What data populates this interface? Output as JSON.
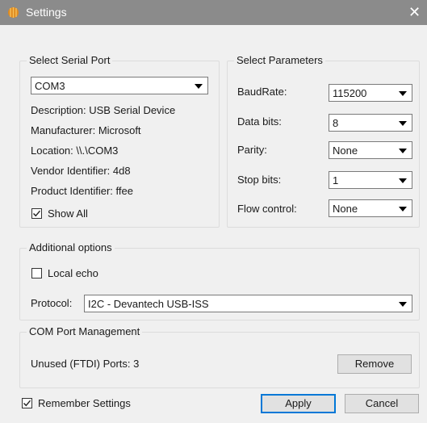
{
  "window": {
    "title": "Settings",
    "close_glyph": "✕"
  },
  "serial_port": {
    "legend": "Select Serial Port",
    "port": "COM3",
    "description": "Description: USB Serial Device",
    "manufacturer": "Manufacturer: Microsoft",
    "location": "Location: \\\\.\\COM3",
    "vendor_id": "Vendor Identifier: 4d8",
    "product_id": "Product Identifier: ffee",
    "show_all_label": "Show All",
    "show_all_checked": true
  },
  "parameters": {
    "legend": "Select Parameters",
    "baud_rate": {
      "label": "BaudRate:",
      "value": "115200"
    },
    "data_bits": {
      "label": "Data bits:",
      "value": "8"
    },
    "parity": {
      "label": "Parity:",
      "value": "None"
    },
    "stop_bits": {
      "label": "Stop bits:",
      "value": "1"
    },
    "flow_control": {
      "label": "Flow control:",
      "value": "None"
    }
  },
  "additional": {
    "legend": "Additional options",
    "local_echo_label": "Local echo",
    "local_echo_checked": false,
    "protocol_label": "Protocol:",
    "protocol_value": "I2C - Devantech USB-ISS"
  },
  "com_mgmt": {
    "legend": "COM Port Management",
    "unused_ports": "Unused (FTDI) Ports: 3",
    "remove_label": "Remove"
  },
  "footer": {
    "remember_label": "Remember Settings",
    "remember_checked": true,
    "apply_label": "Apply",
    "cancel_label": "Cancel"
  },
  "colors": {
    "titlebar": "#8b8b8b",
    "dialog_bg": "#f0f0f0",
    "default_button_border": "#0078d7",
    "app_icon": "#e08a1e"
  }
}
